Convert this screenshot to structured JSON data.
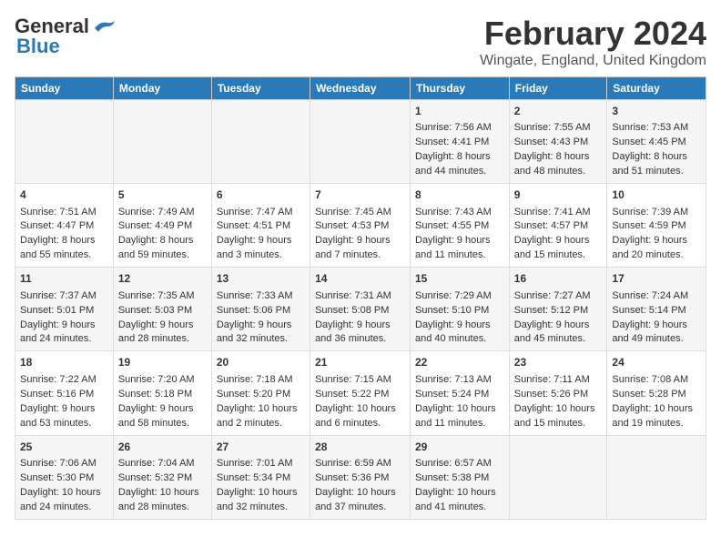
{
  "header": {
    "logo_line1": "General",
    "logo_line2": "Blue",
    "title": "February 2024",
    "subtitle": "Wingate, England, United Kingdom"
  },
  "days_of_week": [
    "Sunday",
    "Monday",
    "Tuesday",
    "Wednesday",
    "Thursday",
    "Friday",
    "Saturday"
  ],
  "weeks": [
    [
      {
        "day": "",
        "info": ""
      },
      {
        "day": "",
        "info": ""
      },
      {
        "day": "",
        "info": ""
      },
      {
        "day": "",
        "info": ""
      },
      {
        "day": "1",
        "info": "Sunrise: 7:56 AM\nSunset: 4:41 PM\nDaylight: 8 hours\nand 44 minutes."
      },
      {
        "day": "2",
        "info": "Sunrise: 7:55 AM\nSunset: 4:43 PM\nDaylight: 8 hours\nand 48 minutes."
      },
      {
        "day": "3",
        "info": "Sunrise: 7:53 AM\nSunset: 4:45 PM\nDaylight: 8 hours\nand 51 minutes."
      }
    ],
    [
      {
        "day": "4",
        "info": "Sunrise: 7:51 AM\nSunset: 4:47 PM\nDaylight: 8 hours\nand 55 minutes."
      },
      {
        "day": "5",
        "info": "Sunrise: 7:49 AM\nSunset: 4:49 PM\nDaylight: 8 hours\nand 59 minutes."
      },
      {
        "day": "6",
        "info": "Sunrise: 7:47 AM\nSunset: 4:51 PM\nDaylight: 9 hours\nand 3 minutes."
      },
      {
        "day": "7",
        "info": "Sunrise: 7:45 AM\nSunset: 4:53 PM\nDaylight: 9 hours\nand 7 minutes."
      },
      {
        "day": "8",
        "info": "Sunrise: 7:43 AM\nSunset: 4:55 PM\nDaylight: 9 hours\nand 11 minutes."
      },
      {
        "day": "9",
        "info": "Sunrise: 7:41 AM\nSunset: 4:57 PM\nDaylight: 9 hours\nand 15 minutes."
      },
      {
        "day": "10",
        "info": "Sunrise: 7:39 AM\nSunset: 4:59 PM\nDaylight: 9 hours\nand 20 minutes."
      }
    ],
    [
      {
        "day": "11",
        "info": "Sunrise: 7:37 AM\nSunset: 5:01 PM\nDaylight: 9 hours\nand 24 minutes."
      },
      {
        "day": "12",
        "info": "Sunrise: 7:35 AM\nSunset: 5:03 PM\nDaylight: 9 hours\nand 28 minutes."
      },
      {
        "day": "13",
        "info": "Sunrise: 7:33 AM\nSunset: 5:06 PM\nDaylight: 9 hours\nand 32 minutes."
      },
      {
        "day": "14",
        "info": "Sunrise: 7:31 AM\nSunset: 5:08 PM\nDaylight: 9 hours\nand 36 minutes."
      },
      {
        "day": "15",
        "info": "Sunrise: 7:29 AM\nSunset: 5:10 PM\nDaylight: 9 hours\nand 40 minutes."
      },
      {
        "day": "16",
        "info": "Sunrise: 7:27 AM\nSunset: 5:12 PM\nDaylight: 9 hours\nand 45 minutes."
      },
      {
        "day": "17",
        "info": "Sunrise: 7:24 AM\nSunset: 5:14 PM\nDaylight: 9 hours\nand 49 minutes."
      }
    ],
    [
      {
        "day": "18",
        "info": "Sunrise: 7:22 AM\nSunset: 5:16 PM\nDaylight: 9 hours\nand 53 minutes."
      },
      {
        "day": "19",
        "info": "Sunrise: 7:20 AM\nSunset: 5:18 PM\nDaylight: 9 hours\nand 58 minutes."
      },
      {
        "day": "20",
        "info": "Sunrise: 7:18 AM\nSunset: 5:20 PM\nDaylight: 10 hours\nand 2 minutes."
      },
      {
        "day": "21",
        "info": "Sunrise: 7:15 AM\nSunset: 5:22 PM\nDaylight: 10 hours\nand 6 minutes."
      },
      {
        "day": "22",
        "info": "Sunrise: 7:13 AM\nSunset: 5:24 PM\nDaylight: 10 hours\nand 11 minutes."
      },
      {
        "day": "23",
        "info": "Sunrise: 7:11 AM\nSunset: 5:26 PM\nDaylight: 10 hours\nand 15 minutes."
      },
      {
        "day": "24",
        "info": "Sunrise: 7:08 AM\nSunset: 5:28 PM\nDaylight: 10 hours\nand 19 minutes."
      }
    ],
    [
      {
        "day": "25",
        "info": "Sunrise: 7:06 AM\nSunset: 5:30 PM\nDaylight: 10 hours\nand 24 minutes."
      },
      {
        "day": "26",
        "info": "Sunrise: 7:04 AM\nSunset: 5:32 PM\nDaylight: 10 hours\nand 28 minutes."
      },
      {
        "day": "27",
        "info": "Sunrise: 7:01 AM\nSunset: 5:34 PM\nDaylight: 10 hours\nand 32 minutes."
      },
      {
        "day": "28",
        "info": "Sunrise: 6:59 AM\nSunset: 5:36 PM\nDaylight: 10 hours\nand 37 minutes."
      },
      {
        "day": "29",
        "info": "Sunrise: 6:57 AM\nSunset: 5:38 PM\nDaylight: 10 hours\nand 41 minutes."
      },
      {
        "day": "",
        "info": ""
      },
      {
        "day": "",
        "info": ""
      }
    ]
  ]
}
